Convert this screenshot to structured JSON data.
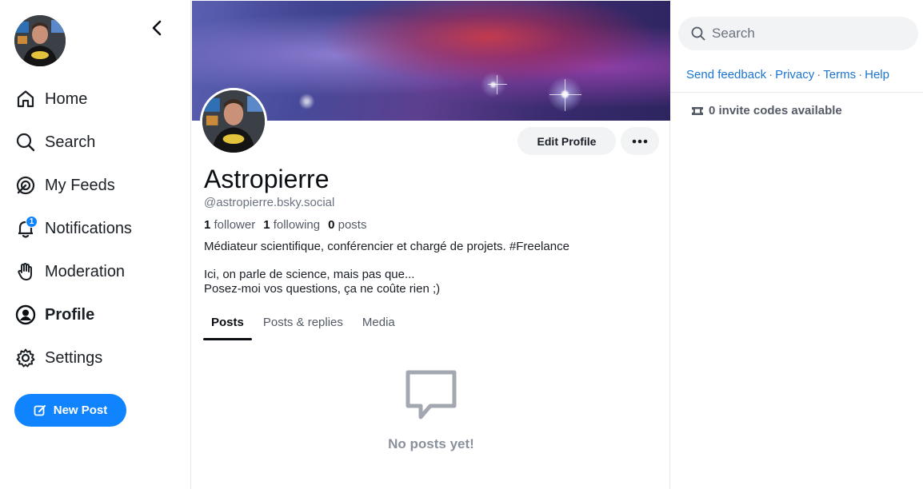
{
  "sidebar": {
    "collapse_icon": "chevron-left-icon",
    "items": [
      {
        "label": "Home",
        "icon": "home-icon"
      },
      {
        "label": "Search",
        "icon": "search-icon"
      },
      {
        "label": "My Feeds",
        "icon": "feeds-icon"
      },
      {
        "label": "Notifications",
        "icon": "bell-icon",
        "badge": "1"
      },
      {
        "label": "Moderation",
        "icon": "hand-icon"
      },
      {
        "label": "Profile",
        "icon": "user-circle-icon",
        "active": true
      },
      {
        "label": "Settings",
        "icon": "gear-icon"
      }
    ],
    "new_post_label": "New Post"
  },
  "profile": {
    "display_name": "Astropierre",
    "handle": "@astropierre.bsky.social",
    "followers_count": "1",
    "followers_label": "follower",
    "following_count": "1",
    "following_label": "following",
    "posts_count": "0",
    "posts_label": "posts",
    "bio_line1": "Médiateur scientifique, conférencier et chargé de projets. #Freelance",
    "bio_line2": "Ici, on parle de science, mais pas que...",
    "bio_line3": "Posez-moi vos questions, ça ne coûte rien ;)",
    "edit_label": "Edit Profile"
  },
  "tabs": [
    "Posts",
    "Posts & replies",
    "Media"
  ],
  "empty_state": {
    "message": "No posts yet!",
    "icon": "message-icon"
  },
  "right": {
    "search_placeholder": "Search",
    "links": [
      "Send feedback",
      "Privacy",
      "Terms",
      "Help"
    ],
    "link_separator": "·",
    "invite_text": "0 invite codes available"
  },
  "colors": {
    "accent": "#1083fe",
    "link": "#1b75d0",
    "muted": "#6b7280"
  }
}
